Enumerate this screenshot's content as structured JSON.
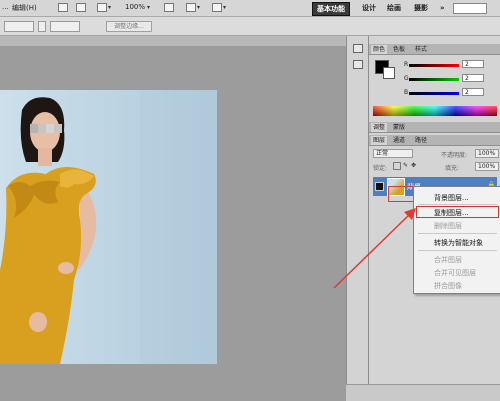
{
  "menubar": {
    "menu_h": "编辑(H)",
    "zoom": "100%",
    "workspaces": [
      "基本功能",
      "设计",
      "绘画",
      "摄影"
    ],
    "more": "»"
  },
  "options": {
    "refine_edge": "调整边缘..."
  },
  "color_panel": {
    "tabs": [
      "颜色",
      "色板",
      "样式"
    ],
    "sliders": [
      {
        "label": "R",
        "value": "2"
      },
      {
        "label": "G",
        "value": "2"
      },
      {
        "label": "B",
        "value": "2"
      }
    ]
  },
  "adjust_panel": {
    "tabs": [
      "调整",
      "蒙版"
    ]
  },
  "layers_panel": {
    "tabs": [
      "图层",
      "通道",
      "路径"
    ],
    "blend_mode": "正常",
    "opacity_label": "不透明度:",
    "opacity_value": "100%",
    "lock_label": "锁定:",
    "fill_label": "填充:",
    "fill_value": "100%",
    "layer_name": "背景",
    "lock_icon": "🔒"
  },
  "context_menu": {
    "items": [
      {
        "label": "背景图层...",
        "enabled": true
      },
      {
        "label": "复制图层...",
        "enabled": true,
        "highlighted": true
      },
      {
        "label": "删除图层",
        "enabled": false
      },
      {
        "label": "转换为智能对象",
        "enabled": true
      },
      {
        "label": "合并图层",
        "enabled": false
      },
      {
        "label": "合并可见图层",
        "enabled": false
      },
      {
        "label": "拼合图像",
        "enabled": false
      }
    ]
  },
  "colors": {
    "annotation_red": "#e03a2f",
    "layer_selected": "#4d7fc3",
    "dress": "#d9a01f"
  }
}
